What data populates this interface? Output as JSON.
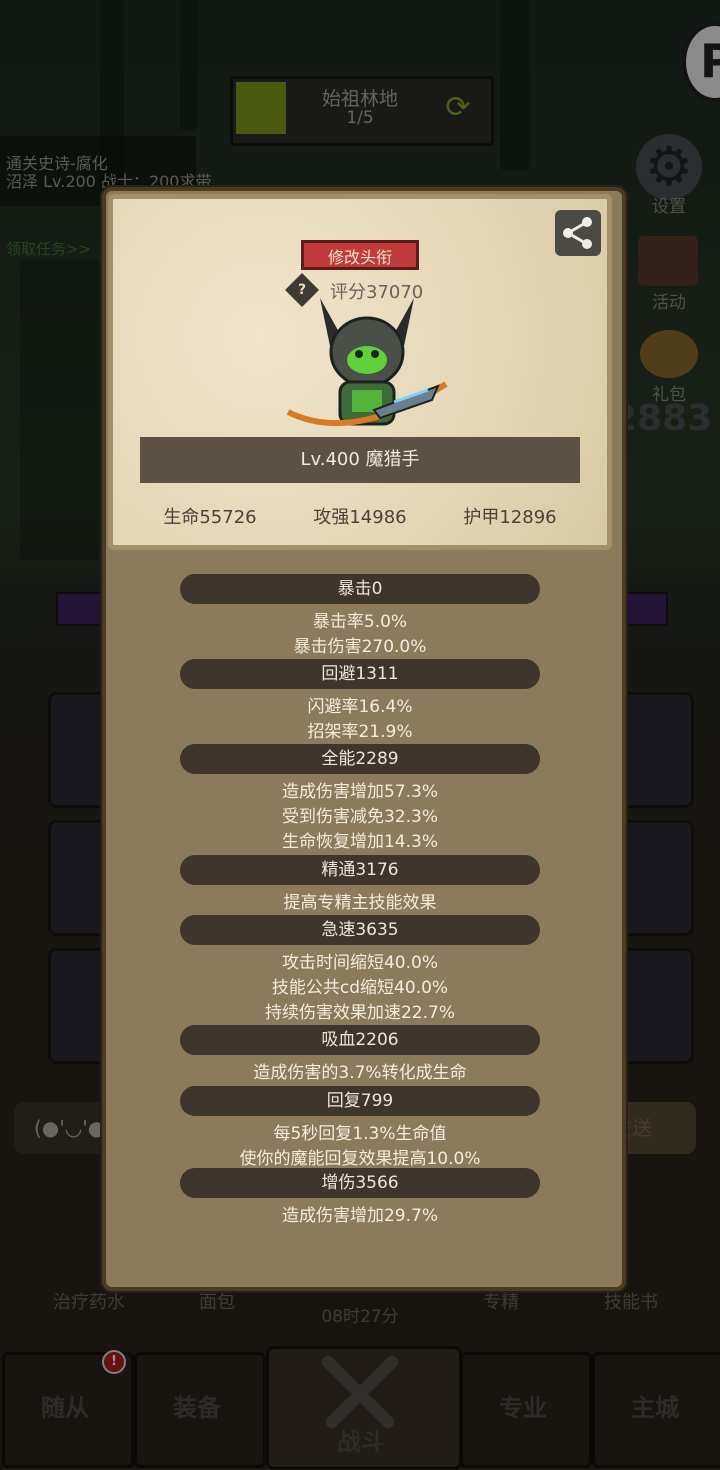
{
  "map": {
    "name": "始祖林地",
    "page": "1/5"
  },
  "quest": {
    "line1": "通关史诗-腐化",
    "line2": "沼泽 Lv.200 战士：200求带",
    "link": "领取任务>>"
  },
  "side_menu": {
    "settings": "设置",
    "activity": "活动",
    "gift": "礼包",
    "score_fragment": "2883"
  },
  "chat": {
    "emote": "(●'◡'●",
    "send": "发送"
  },
  "bottom_items": [
    "治疗药水",
    "面包",
    "专精",
    "技能书"
  ],
  "timer": "08时27分",
  "nav": {
    "items": [
      "随从",
      "装备",
      "战斗",
      "专业",
      "主城"
    ],
    "alert": "!"
  },
  "profile": {
    "change_title_button": "修改头衔",
    "help_icon": "?",
    "rating": "评分37070",
    "name_line": "Lv.400 魔猎手",
    "hp": "生命55726",
    "attack": "攻强14986",
    "armor": "护甲12896"
  },
  "stats": [
    {
      "header": "暴击0",
      "lines": [
        "暴击率5.0%",
        "暴击伤害270.0%"
      ]
    },
    {
      "header": "回避1311",
      "lines": [
        "闪避率16.4%",
        "招架率21.9%"
      ]
    },
    {
      "header": "全能2289",
      "lines": [
        "造成伤害增加57.3%",
        "受到伤害减免32.3%",
        "生命恢复增加14.3%"
      ]
    },
    {
      "header": "精通3176",
      "lines": [
        "提高专精主技能效果"
      ]
    },
    {
      "header": "急速3635",
      "lines": [
        "攻击时间缩短40.0%",
        "技能公共cd缩短40.0%",
        "持续伤害效果加速22.7%"
      ]
    },
    {
      "header": "吸血2206",
      "lines": [
        "造成伤害的3.7%转化成生命"
      ]
    },
    {
      "header": "回复799",
      "lines": [
        "每5秒回复1.3%生命值",
        "使你的魔能回复效果提高10.0%"
      ]
    },
    {
      "header": "增伤3566",
      "lines": [
        "造成伤害增加29.7%"
      ]
    }
  ],
  "colors": {
    "card": "#e8dcbf",
    "panel": "#8c7a5d",
    "pill": "#3f362b",
    "title_button": "#c23b3b",
    "hero_green": "#5fd13a"
  }
}
